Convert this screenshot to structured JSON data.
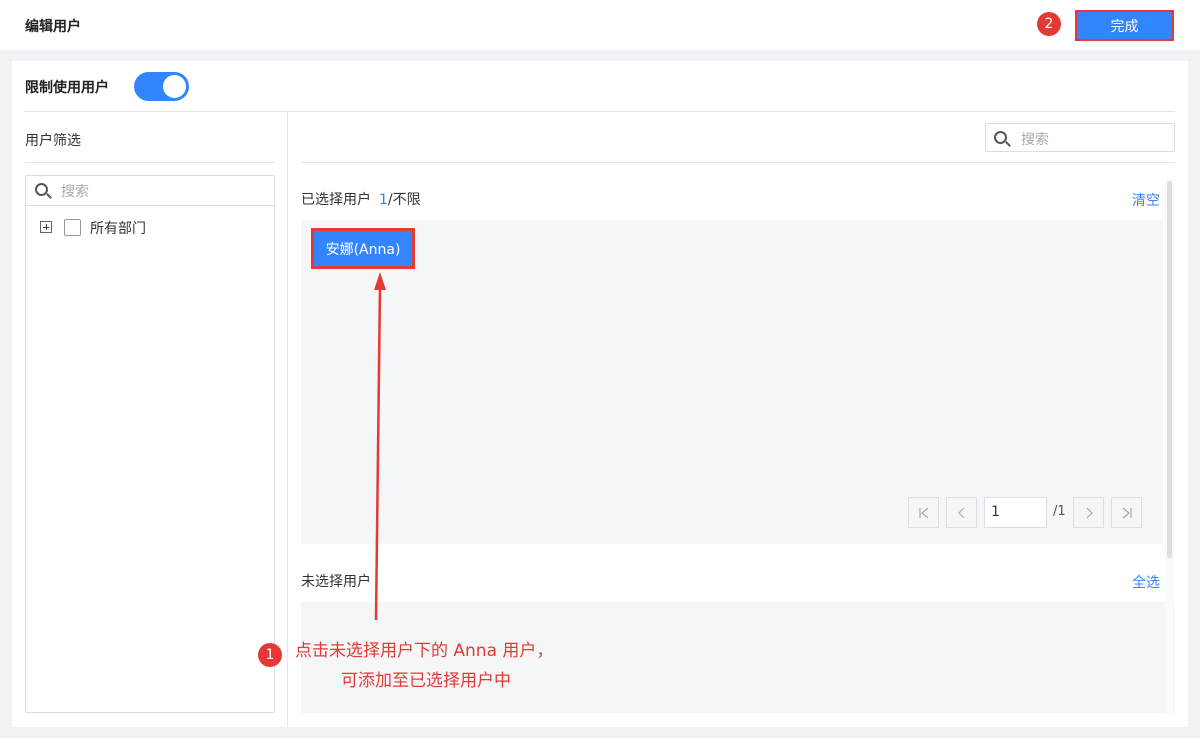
{
  "header": {
    "title": "编辑用户",
    "done_label": "完成"
  },
  "restrict": {
    "label": "限制使用用户",
    "enabled": true
  },
  "filter": {
    "title": "用户筛选",
    "search_placeholder": "搜索",
    "tree": [
      {
        "label": "所有部门",
        "expandable": true,
        "checked": false
      }
    ]
  },
  "right_search": {
    "placeholder": "搜索"
  },
  "selected": {
    "title": "已选择用户",
    "count": "1",
    "limit": "/不限",
    "clear_label": "清空",
    "users": [
      "安娜(Anna)"
    ]
  },
  "pagination": {
    "current_page": "1",
    "total": "/1"
  },
  "unselected": {
    "title": "未选择用户",
    "select_all_label": "全选"
  },
  "annotations": {
    "step1_badge": "1",
    "step2_badge": "2",
    "step1_line1": "点击未选择用户下的 Anna 用户，",
    "step1_line2": "可添加至已选择用户中",
    "color": "#e53935"
  },
  "colors": {
    "accent": "#3385ff",
    "highlight": "#e53935"
  }
}
